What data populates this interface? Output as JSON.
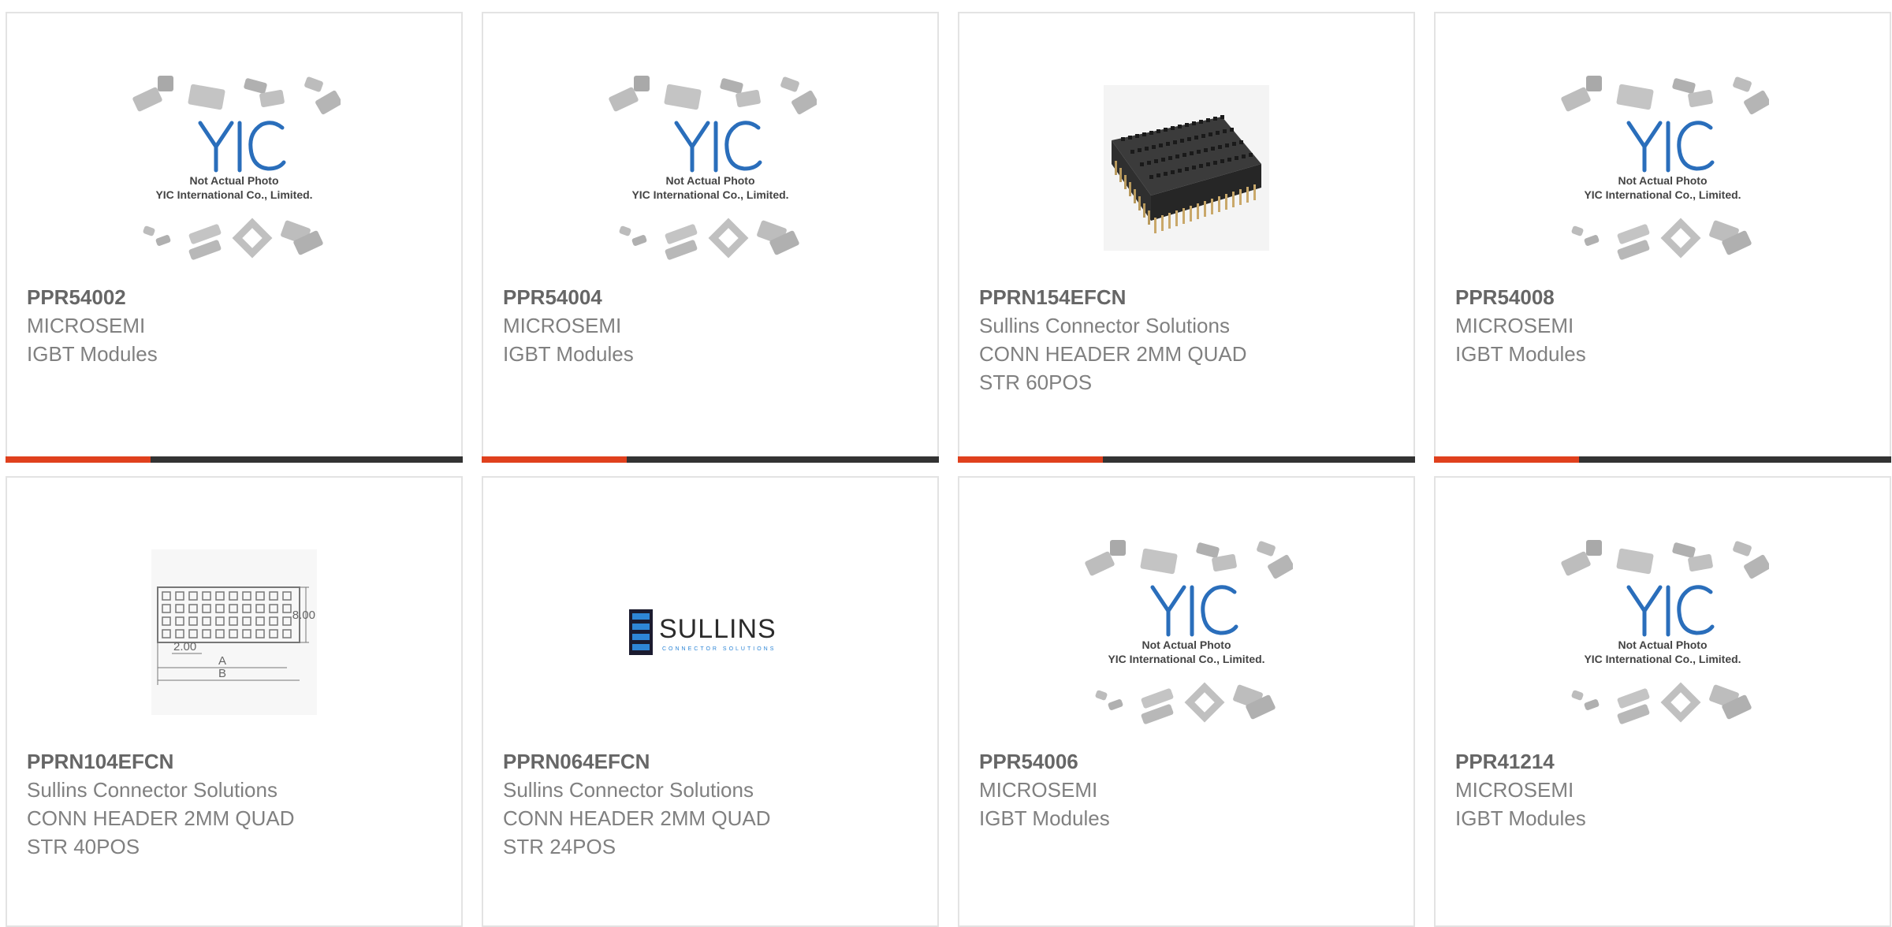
{
  "accent_color": "#e0401d",
  "placeholder_caption": [
    "Not Actual Photo",
    "YIC International Co., Limited."
  ],
  "placeholder_logo": "YIC",
  "products": [
    {
      "part": "PPR54002",
      "maker": "MICROSEMI",
      "desc": [
        "IGBT Modules"
      ],
      "image": "yic-placeholder-icon",
      "bar": true
    },
    {
      "part": "PPR54004",
      "maker": "MICROSEMI",
      "desc": [
        "IGBT Modules"
      ],
      "image": "yic-placeholder-icon",
      "bar": true
    },
    {
      "part": "PPRN154EFCN",
      "maker": "Sullins Connector Solutions",
      "desc": [
        "CONN HEADER 2MM QUAD",
        "STR 60POS"
      ],
      "image": "header-connector-icon",
      "bar": true
    },
    {
      "part": "PPR54008",
      "maker": "MICROSEMI",
      "desc": [
        "IGBT Modules"
      ],
      "image": "yic-placeholder-icon",
      "bar": true
    },
    {
      "part": "PPRN104EFCN",
      "maker": "Sullins Connector Solutions",
      "desc": [
        "CONN HEADER 2MM QUAD",
        "STR 40POS"
      ],
      "image": "dimension-drawing-icon",
      "bar": false
    },
    {
      "part": "PPRN064EFCN",
      "maker": "Sullins Connector Solutions",
      "desc": [
        "CONN HEADER 2MM QUAD",
        "STR 24POS"
      ],
      "image": "sullins-logo-icon",
      "bar": false
    },
    {
      "part": "PPR54006",
      "maker": "MICROSEMI",
      "desc": [
        "IGBT Modules"
      ],
      "image": "yic-placeholder-icon",
      "bar": false
    },
    {
      "part": "PPR41214",
      "maker": "MICROSEMI",
      "desc": [
        "IGBT Modules"
      ],
      "image": "yic-placeholder-icon",
      "bar": false
    }
  ],
  "drawing_labels": {
    "height": "8.00",
    "pitch": "2.00",
    "a": "A",
    "b": "B"
  },
  "sullins_logo": {
    "name": "SULLINS",
    "tagline": "CONNECTOR SOLUTIONS"
  }
}
